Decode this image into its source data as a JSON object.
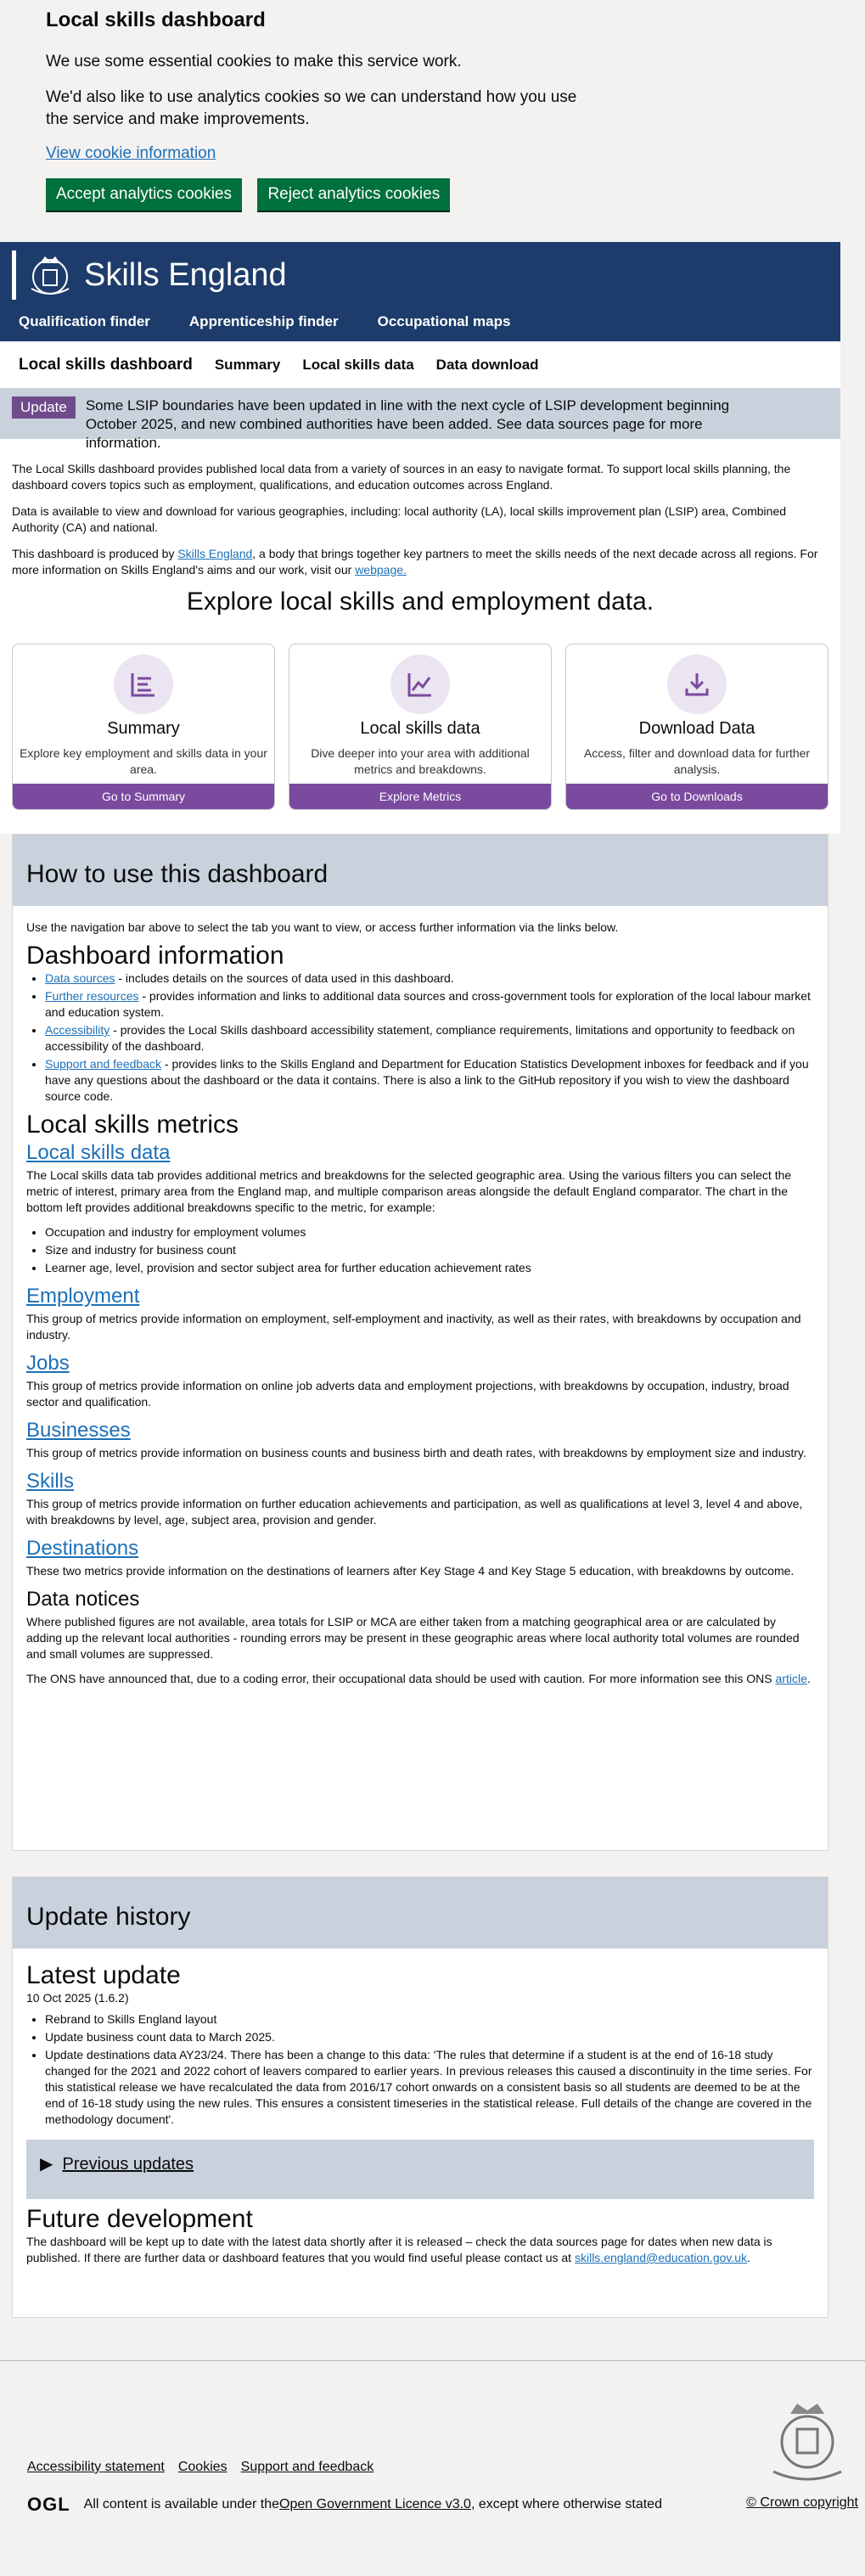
{
  "cookie": {
    "title": "Local skills dashboard",
    "p1": "We use some essential cookies to make this service work.",
    "p2": "We'd also like to use analytics cookies so we can understand how you use the service and make improvements.",
    "link": "View cookie information",
    "accept": "Accept analytics cookies",
    "reject": "Reject analytics cookies"
  },
  "header": {
    "brand": "Skills England",
    "nav": [
      "Qualification finder",
      "Apprenticeship finder",
      "Occupational maps"
    ]
  },
  "subnav": [
    "Local skills dashboard",
    "Summary",
    "Local skills data",
    "Data download"
  ],
  "update": {
    "tag": "Update",
    "text": "Some LSIP boundaries have been updated in line with the next cycle of LSIP development beginning October 2025, and new combined authorities have been added. See data sources page for more information."
  },
  "intro": {
    "p1": "The Local Skills dashboard provides published local data from a variety of sources in an easy to navigate format. To support local skills planning, the dashboard covers topics such as employment, qualifications, and education outcomes across England.",
    "p2": "Data is available to view and download for various geographies, including: local authority (LA), local skills improvement plan (LSIP) area, Combined Authority (CA) and national.",
    "p3a": "This dashboard is produced by ",
    "p3link": "Skills England",
    "p3b": ", a body that brings together key partners to meet the skills needs of the next decade across all regions. For more information on Skills England's aims and our work, visit our ",
    "p3link2": "webpage."
  },
  "explore": "Explore local skills and employment data.",
  "cards": [
    {
      "title": "Summary",
      "desc": "Explore key employment and skills data in your area.",
      "button": "Go to Summary",
      "icon": "list-icon"
    },
    {
      "title": "Local skills data",
      "desc": "Dive deeper into your area with additional metrics and breakdowns.",
      "button": "Explore Metrics",
      "icon": "line-chart-icon"
    },
    {
      "title": "Download Data",
      "desc": "Access, filter and download data for further analysis.",
      "button": "Go to Downloads",
      "icon": "download-icon"
    }
  ],
  "how": {
    "title": "How to use this dashboard",
    "lead": "Use the navigation bar above to select the tab you want to view, or access further information via the links below.",
    "dash_info": "Dashboard information",
    "info_items": [
      {
        "link": "Data sources",
        "text": " - includes details on the sources of data used in this dashboard."
      },
      {
        "link": "Further resources",
        "text": " - provides information and links to additional data sources and cross-government tools for exploration of the local labour market and education system."
      },
      {
        "link": "Accessibility",
        "text": " - provides the Local Skills dashboard accessibility statement, compliance requirements, limitations and opportunity to feedback on accessibility of the dashboard."
      },
      {
        "link": "Support and feedback",
        "text": " - provides links to the Skills England and Department for Education Statistics Development inboxes for feedback and if you have any questions about the dashboard or the data it contains. There is also a link to the GitHub repository if you wish to view the dashboard source code."
      }
    ],
    "metrics": "Local skills metrics",
    "lsd_title": "Local skills data",
    "lsd_text": "The Local skills data tab provides additional metrics and breakdowns for the selected geographic area. Using the various filters you can select the metric of interest, primary area from the England map, and multiple comparison areas alongside the default England comparator. The chart in the bottom left provides additional breakdowns specific to the metric, for example:",
    "lsd_items": [
      "Occupation and industry for employment volumes",
      "Size and industry for business count",
      "Learner age, level, provision and sector subject area for further education achievement rates"
    ],
    "emp_title": "Employment",
    "emp_text": "This group of metrics provide information on employment, self-employment and inactivity, as well as their rates, with breakdowns by occupation and industry.",
    "jobs_title": "Jobs",
    "jobs_text": "This group of metrics provide information on online job adverts data and employment projections, with breakdowns by occupation, industry, broad sector and qualification.",
    "bus_title": "Businesses",
    "bus_text": "This group of metrics provide information on business counts and business birth and death rates, with breakdowns by employment size and industry.",
    "skills_title": "Skills",
    "skills_text": "This group of metrics provide information on further education achievements and participation, as well as qualifications at level 3, level 4 and above, with breakdowns by level, age, subject area, provision and gender.",
    "dest_title": "Destinations",
    "dest_text": "These two metrics provide information on the destinations of learners after Key Stage 4 and Key Stage 5 education, with breakdowns by outcome.",
    "notices_title": "Data notices",
    "notices_p1": "Where published figures are not available, area totals for LSIP or MCA are either taken from a matching geographical area or are calculated by adding up the relevant local authorities - rounding errors may be present in these geographic areas where local authority total volumes are rounded and small volumes are suppressed.",
    "notices_p2a": "The ONS have announced that, due to a coding error, their occupational data should be used with caution. For more information see this ONS ",
    "notices_link": "article",
    "notices_p2b": "."
  },
  "history": {
    "title": "Update history",
    "latest": "Latest update",
    "date": "10 Oct 2025 (1.6.2)",
    "items": [
      "Rebrand to Skills England layout",
      "Update business count data to March 2025.",
      "Update destinations data AY23/24. There has been a change to this data: 'The rules that determine if a student is at the end of 16-18 study changed for the 2021 and 2022 cohort of leavers compared to earlier years. In previous releases this caused a discontinuity in the time series. For this statistical release we have recalculated the data from 2016/17 cohort onwards on a consistent basis so all students are deemed to be at the end of 16-18 study using the new rules. This ensures a consistent timeseries in the statistical release. Full details of the change are covered in the methodology document'."
    ],
    "previous": "Previous updates",
    "future": "Future development",
    "future_text_a": "The dashboard will be kept up to date with the latest data shortly after it is released – check the data sources page for dates when new data is published. If there are further data or dashboard features that you would find useful please contact us at ",
    "future_link": "skills.england@education.gov.uk",
    "future_text_b": "."
  },
  "footer": {
    "links": [
      "Accessibility statement",
      "Cookies",
      "Support and feedback"
    ],
    "ogl": "OGL",
    "licence_a": "All content is available under the ",
    "licence_link": "Open Government Licence v3.0",
    "licence_b": ", except where otherwise stated",
    "crown": "© Crown copyright"
  }
}
